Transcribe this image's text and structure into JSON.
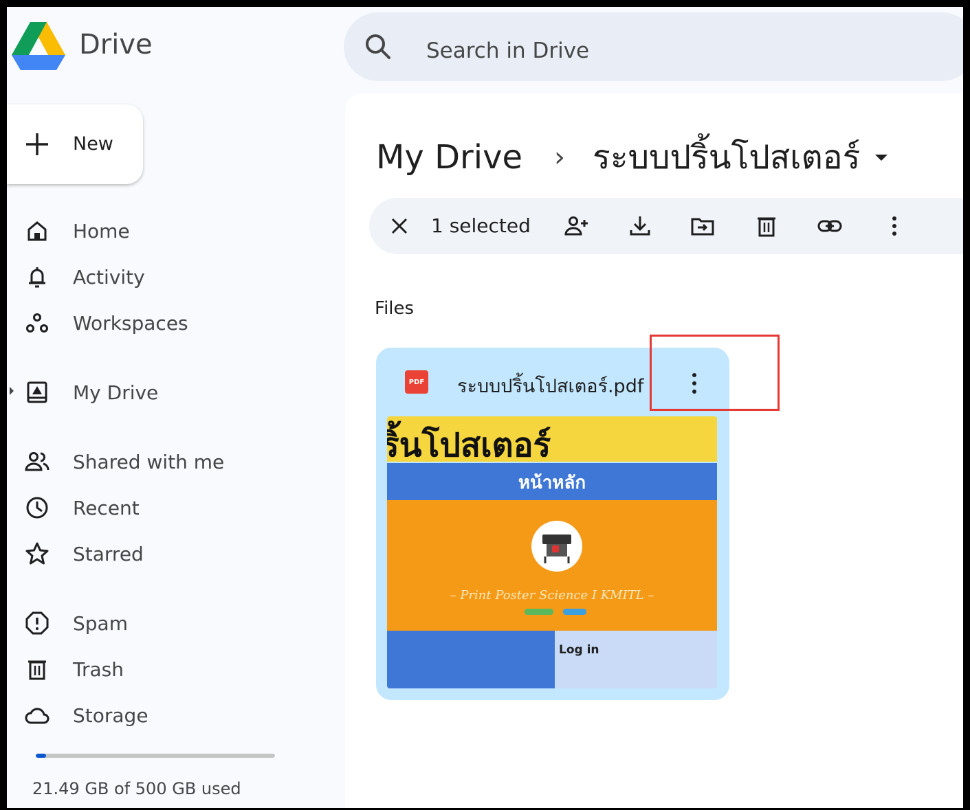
{
  "app": {
    "name": "Drive"
  },
  "search": {
    "placeholder": "Search in Drive"
  },
  "sidebar": {
    "new_label": "New",
    "items": [
      {
        "label": "Home",
        "icon": "home-icon"
      },
      {
        "label": "Activity",
        "icon": "bell-icon"
      },
      {
        "label": "Workspaces",
        "icon": "workspaces-icon"
      },
      {
        "label": "My Drive",
        "icon": "my-drive-icon"
      },
      {
        "label": "Shared with me",
        "icon": "people-icon"
      },
      {
        "label": "Recent",
        "icon": "clock-icon"
      },
      {
        "label": "Starred",
        "icon": "star-icon"
      },
      {
        "label": "Spam",
        "icon": "spam-icon"
      },
      {
        "label": "Trash",
        "icon": "trash-icon"
      },
      {
        "label": "Storage",
        "icon": "cloud-icon"
      }
    ],
    "storage": {
      "used_fraction": 0.043,
      "text": "21.49 GB of 500 GB used"
    }
  },
  "breadcrumb": {
    "root": "My Drive",
    "separator": "›",
    "current": "ระบบปริ้นโปสเตอร์"
  },
  "selection_bar": {
    "count_label": "1 selected",
    "actions": [
      "close-icon",
      "share-icon",
      "download-icon",
      "move-icon",
      "trash-icon",
      "link-icon",
      "more-vert-icon"
    ]
  },
  "files": {
    "section_title": "Files",
    "items": [
      {
        "name": "ระบบปริ้นโปสเตอร์.pdf",
        "type_badge": "PDF",
        "preview": {
          "title": "ริ้นโปสเตอร์",
          "nav": "หน้าหลัก",
          "tagline": "– Print Poster Science I KMITL –",
          "login": "Log in"
        }
      }
    ]
  },
  "colors": {
    "accent": "#0b57d0",
    "selected_card": "#c2e7ff",
    "highlight": "#e53935"
  }
}
